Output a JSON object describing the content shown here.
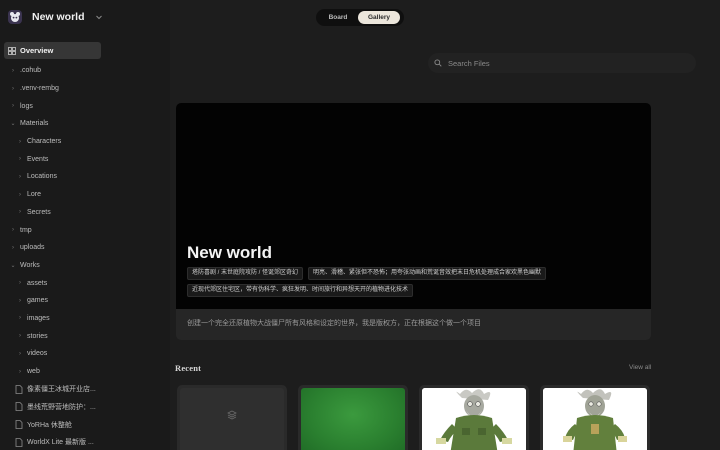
{
  "workspace": {
    "name": "New world"
  },
  "sidebar": {
    "overview_label": "Overview",
    "items": [
      {
        "label": ".cohub",
        "level": 0,
        "expanded": false
      },
      {
        "label": ".venv-rembg",
        "level": 0,
        "expanded": false
      },
      {
        "label": "logs",
        "level": 0,
        "expanded": false
      },
      {
        "label": "Materials",
        "level": 0,
        "expanded": true
      },
      {
        "label": "Characters",
        "level": 1,
        "expanded": false
      },
      {
        "label": "Events",
        "level": 1,
        "expanded": false
      },
      {
        "label": "Locations",
        "level": 1,
        "expanded": false
      },
      {
        "label": "Lore",
        "level": 1,
        "expanded": false
      },
      {
        "label": "Secrets",
        "level": 1,
        "expanded": false
      },
      {
        "label": "tmp",
        "level": 0,
        "expanded": false
      },
      {
        "label": "uploads",
        "level": 0,
        "expanded": false
      },
      {
        "label": "Works",
        "level": 0,
        "expanded": true
      },
      {
        "label": "assets",
        "level": 1,
        "expanded": false
      },
      {
        "label": "games",
        "level": 1,
        "expanded": false
      },
      {
        "label": "images",
        "level": 1,
        "expanded": false
      },
      {
        "label": "stories",
        "level": 1,
        "expanded": false
      },
      {
        "label": "videos",
        "level": 1,
        "expanded": false
      },
      {
        "label": "web",
        "level": 1,
        "expanded": false
      },
      {
        "label": "像素僵王冰城开业店...",
        "level": 0,
        "file": true
      },
      {
        "label": "墨线荒野营地防护：...",
        "level": 0,
        "file": true
      },
      {
        "label": "YoRHa 休整舱",
        "level": 0,
        "file": true
      },
      {
        "label": "WorldX Lite 最新版 ...",
        "level": 0,
        "file": true
      }
    ]
  },
  "view_toggle": {
    "board_label": "Board",
    "gallery_label": "Gallery",
    "active": "Gallery"
  },
  "search": {
    "placeholder": "Search Files"
  },
  "hero": {
    "title": "New world",
    "tags": [
      "塔防喜剧 / 末世庭院攻防 / 怪诞郊区奇幻",
      "明亮、滑稽、紧张但不恐怖；用夸张动画和荒诞音效把末日危机处理成合家欢黑色幽默",
      "近现代郊区住宅区，带有伪科学、疯狂发明、时间旅行和异想天开的植物进化技术"
    ],
    "description": "创建一个完全还原植物大战僵尸所有风格和设定的世界，我是版权方，正在根据这个做一个项目"
  },
  "recent": {
    "title": "Recent",
    "view_all_label": "View all"
  },
  "colors": {
    "background": "#1d1d1d",
    "sidebar": "#1a1a1a",
    "accent_toggle": "#ece6dc",
    "green_card": "#2a7f2f"
  },
  "icons": [
    "workspace-logo",
    "chevron-down-icon",
    "overview-icon",
    "search-icon",
    "document-icon",
    "stack-icon"
  ]
}
